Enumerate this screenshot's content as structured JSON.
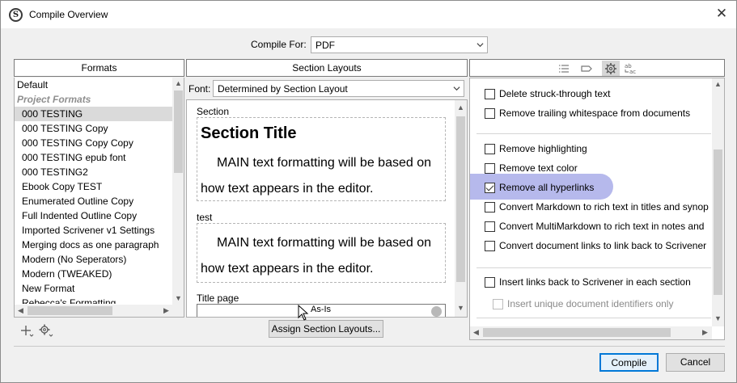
{
  "window": {
    "title": "Compile Overview",
    "app_icon": "S",
    "close_glyph": "✕"
  },
  "compile_for": {
    "label": "Compile For:",
    "value": "PDF"
  },
  "formats_panel": {
    "header": "Formats",
    "items": [
      {
        "label": "Default",
        "type": "item"
      },
      {
        "label": "Project Formats",
        "type": "group"
      },
      {
        "label": "000 TESTING",
        "type": "item",
        "selected": true
      },
      {
        "label": "000 TESTING Copy",
        "type": "item"
      },
      {
        "label": "000 TESTING Copy Copy",
        "type": "item"
      },
      {
        "label": "000 TESTING epub font",
        "type": "item"
      },
      {
        "label": "000 TESTING2",
        "type": "item"
      },
      {
        "label": "Ebook Copy TEST",
        "type": "item"
      },
      {
        "label": "Enumerated Outline Copy",
        "type": "item"
      },
      {
        "label": "Full Indented Outline Copy",
        "type": "item"
      },
      {
        "label": "Imported Scrivener v1 Settings",
        "type": "item"
      },
      {
        "label": "Merging docs as one paragraph",
        "type": "item"
      },
      {
        "label": "Modern (No Seperators)",
        "type": "item"
      },
      {
        "label": "Modern (TWEAKED)",
        "type": "item"
      },
      {
        "label": "New Format",
        "type": "item"
      },
      {
        "label": "Rebecca's Formatting",
        "type": "item"
      }
    ],
    "add_icon": "add-format-icon",
    "settings_icon": "gear-icon"
  },
  "section_layouts_panel": {
    "header": "Section Layouts",
    "font_label": "Font:",
    "font_value": "Determined by Section Layout",
    "layouts": [
      {
        "name": "Section",
        "title": "Section Title",
        "body": "MAIN text formatting will be based on how text appears in the editor."
      },
      {
        "name": "test",
        "body": "MAIN text formatting will be based on how text appears in the editor."
      },
      {
        "name": "Title page",
        "body": "As-Is"
      }
    ],
    "assign_button": "Assign Section Layouts..."
  },
  "options_panel": {
    "tool_icons": [
      "list-icon",
      "tag-icon",
      "gear-icon",
      "replace-text-icon"
    ],
    "options": [
      {
        "label": "Delete struck-through text",
        "checked": false
      },
      {
        "label": "Remove trailing whitespace from documents",
        "checked": false
      },
      {
        "label": "Remove highlighting",
        "checked": false
      },
      {
        "label": "Remove text color",
        "checked": false
      },
      {
        "label": "Remove all hyperlinks",
        "checked": true
      },
      {
        "label": "Convert Markdown to rich text in titles and synop",
        "checked": false
      },
      {
        "label": "Convert MultiMarkdown to rich text in notes and",
        "checked": false
      },
      {
        "label": "Convert document links to link back to Scrivener",
        "checked": false
      },
      {
        "label": "Insert links back to Scrivener in each section",
        "checked": false
      },
      {
        "label": "Insert unique document identifiers only",
        "checked": false,
        "disabled": true
      }
    ]
  },
  "footer": {
    "compile_button": "Compile",
    "cancel_button": "Cancel"
  },
  "colors": {
    "highlight": "#9ea1e6",
    "default_button_border": "#0078d7",
    "selection": "#dadada"
  }
}
